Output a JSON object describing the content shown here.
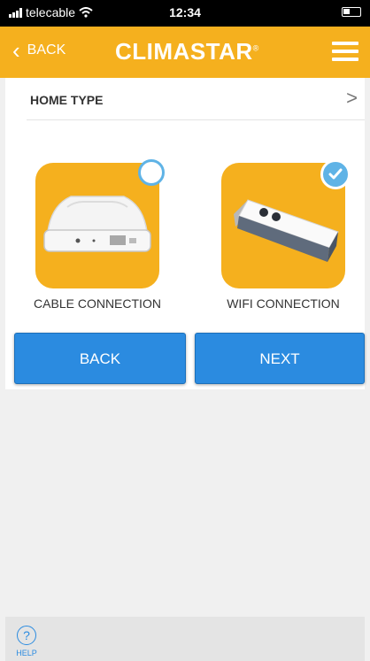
{
  "status_bar": {
    "carrier": "telecable",
    "time": "12:34",
    "signal_icon": "signal-bars-icon",
    "wifi_icon": "wifi-icon",
    "battery_icon": "battery-icon"
  },
  "header": {
    "back_label": "BACK",
    "brand_name": "CLIMASTAR",
    "brand_mark": "®",
    "menu_icon": "hamburger-menu-icon",
    "background_color": "#f5b01e"
  },
  "home_type": {
    "label": "HOME TYPE",
    "chevron": ">"
  },
  "options": [
    {
      "label": "CABLE CONNECTION",
      "selected": false,
      "icon": "cable-device-icon"
    },
    {
      "label": "WIFI CONNECTION",
      "selected": true,
      "icon": "wifi-dongle-icon"
    }
  ],
  "buttons": {
    "back_label": "BACK",
    "next_label": "NEXT",
    "color": "#2b8be0"
  },
  "footer": {
    "help_symbol": "?",
    "help_label": "HELP"
  }
}
